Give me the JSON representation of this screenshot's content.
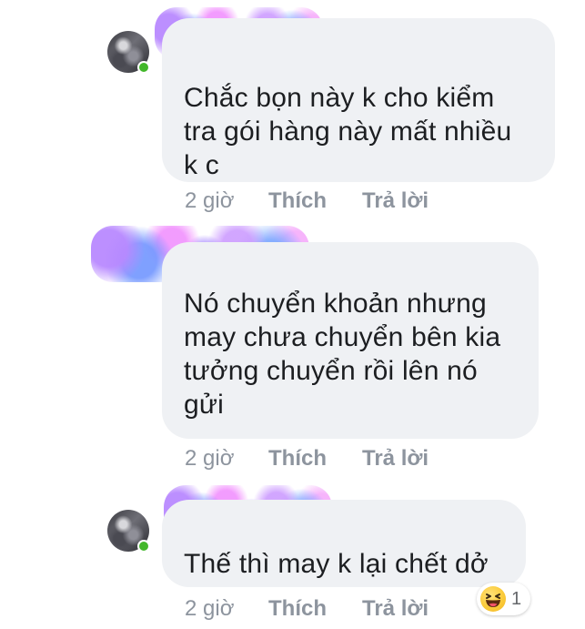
{
  "comments": [
    {
      "text_lines": [
        "Chắc bọn này k cho kiểm",
        "tra gói hàng này mất nhiều",
        "k c"
      ],
      "time": "2 giờ",
      "like_label": "Thích",
      "reply_label": "Trả lời",
      "has_avatar": true
    },
    {
      "text_lines": [
        "Nó chuyển khoản nhưng",
        "may chưa chuyển bên kia",
        "tưởng chuyển rồi lên nó",
        "gửi"
      ],
      "time": "2 giờ",
      "like_label": "Thích",
      "reply_label": "Trả lời",
      "has_avatar": false
    },
    {
      "text_lines": [
        "Thế thì may k lại chết dở"
      ],
      "time": "2 giờ",
      "like_label": "Thích",
      "reply_label": "Trả lời",
      "has_avatar": true,
      "reaction": {
        "icon": "haha-emoji-icon",
        "count": "1"
      }
    }
  ],
  "colors": {
    "bubble_bg": "#eff1f4",
    "meta_text": "#8d949e",
    "online_green": "#42b72a"
  }
}
